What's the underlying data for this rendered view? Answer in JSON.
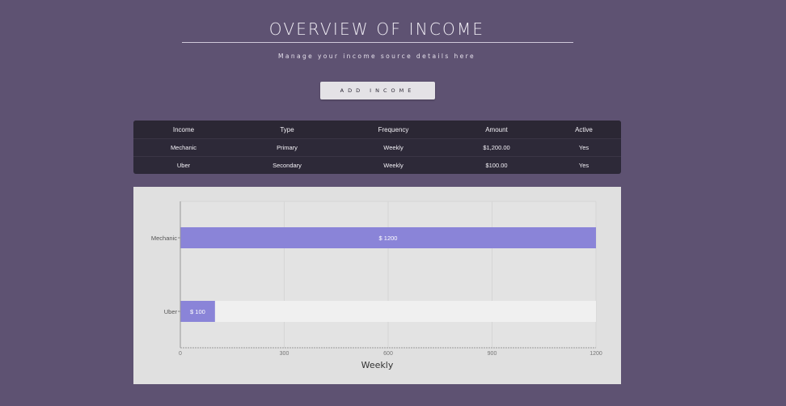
{
  "header": {
    "title": "OVERVIEW OF INCOME",
    "subtitle": "Manage your income source details here",
    "add_button_label": "ADD INCOME"
  },
  "table": {
    "columns": [
      "Income",
      "Type",
      "Frequency",
      "Amount",
      "Active"
    ],
    "rows": [
      [
        "Mechanic",
        "Primary",
        "Weekly",
        "$1,200.00",
        "Yes"
      ],
      [
        "Uber",
        "Secondary",
        "Weekly",
        "$100.00",
        "Yes"
      ]
    ]
  },
  "chart_data": {
    "type": "bar",
    "orientation": "horizontal",
    "categories": [
      "Mechanic",
      "Uber"
    ],
    "values": [
      1200,
      100
    ],
    "data_labels": [
      "$ 1200",
      "$ 100"
    ],
    "xlabel": "Weekly",
    "xlim": [
      0,
      1200
    ],
    "xticks": [
      0,
      300,
      600,
      900,
      1200
    ],
    "grid": true,
    "colors": {
      "bar": "#8a84d8",
      "track": "#f0f0f0",
      "background": "#e0e0e0"
    }
  },
  "colors": {
    "page_background": "#5e5272",
    "table_background": "#2d2938",
    "button_background": "#e4e2e6"
  }
}
